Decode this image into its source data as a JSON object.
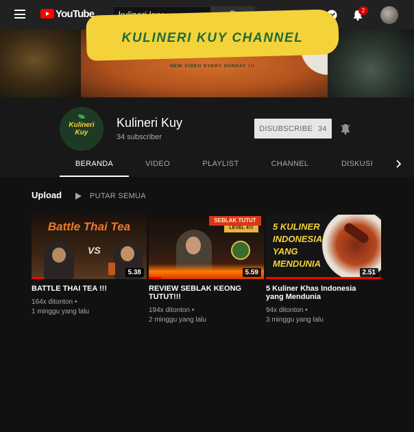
{
  "topbar": {
    "logo_text": "YouTube",
    "logo_region": "ID",
    "search_value": "kulineri kuy",
    "notification_count": "2"
  },
  "banner": {
    "title": "KULINERI KUY CHANNEL",
    "subtitle": "NEW VIDEO EVERY SUNDAY !!!"
  },
  "channel": {
    "avatar_text_line1": "Kulineri",
    "avatar_text_line2": "Kuy",
    "name": "Kulineri Kuy",
    "subscribers": "34 subscriber",
    "unsubscribe_label": "DISUBSCRIBE",
    "unsubscribe_count": "34"
  },
  "tabs": [
    {
      "label": "BERANDA",
      "active": true
    },
    {
      "label": "VIDEO"
    },
    {
      "label": "PLAYLIST"
    },
    {
      "label": "CHANNEL"
    },
    {
      "label": "DISKUSI"
    }
  ],
  "uploads": {
    "title": "Upload",
    "play_all": "PUTAR SEMUA",
    "videos": [
      {
        "title": "BATTLE THAI TEA !!!",
        "views": "164x ditonton",
        "age": "1 minggu yang lalu",
        "duration": "5.38",
        "thumb_text": "Battle Thai Tea",
        "thumb_vs": "VS",
        "watched": 0.11
      },
      {
        "title": "REVIEW SEBLAK KEONG TUTUT!!!",
        "views": "194x ditonton",
        "age": "2 minggu yang lalu",
        "duration": "5.59",
        "thumb_text": "SEBLAK TUTUT",
        "thumb_subtext": "LEVEL 4!!!",
        "watched": 0.11
      },
      {
        "title": "5 Kuliner Khas Indonesia yang Mendunia",
        "views": "94x ditonton",
        "age": "3 minggu yang lalu",
        "duration": "2.51",
        "thumb_text_1": "5 KULINER",
        "thumb_text_2": "INDONESIA",
        "thumb_text_3": "YANG",
        "thumb_text_4": "MENDUNIA",
        "watched": 1.0
      }
    ]
  },
  "colors": {
    "brand_red": "#ff0000",
    "background": "#111111",
    "header_bg": "#181818",
    "topbar_bg": "#212121",
    "banner_yellow": "#f4d33a",
    "banner_green": "#1f6b3a"
  }
}
